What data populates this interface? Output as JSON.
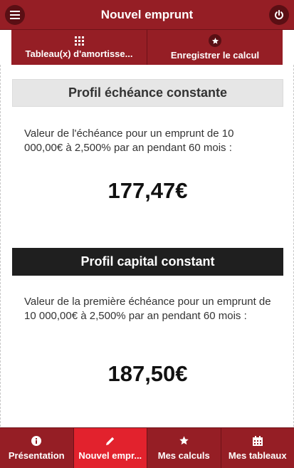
{
  "app": {
    "title": "Nouvel emprunt",
    "accent_color": "#951e25",
    "active_color": "#e2222d",
    "menu_icon": "menu-icon",
    "power_icon": "power-icon"
  },
  "actions": [
    {
      "label": "Tableau(x) d'amortisse...",
      "icon": "grid-icon"
    },
    {
      "label": "Enregistrer le calcul",
      "icon": "star-icon"
    }
  ],
  "profiles": [
    {
      "title": "Profil échéance constante",
      "description": "Valeur de l'échéance pour un emprunt de 10 000,00€ à 2,500% par an pendant 60 mois :",
      "amount": "177,47€"
    },
    {
      "title": "Profil capital constant",
      "description": "Valeur de la première échéance pour un emprunt de 10 000,00€ à 2,500% par an pendant 60 mois :",
      "amount": "187,50€"
    }
  ],
  "nav": [
    {
      "label": "Présentation",
      "icon": "info-icon",
      "active": false
    },
    {
      "label": "Nouvel empr...",
      "icon": "pencil-icon",
      "active": true
    },
    {
      "label": "Mes calculs",
      "icon": "star-icon",
      "active": false
    },
    {
      "label": "Mes tableaux",
      "icon": "calendar-icon",
      "active": false
    }
  ]
}
